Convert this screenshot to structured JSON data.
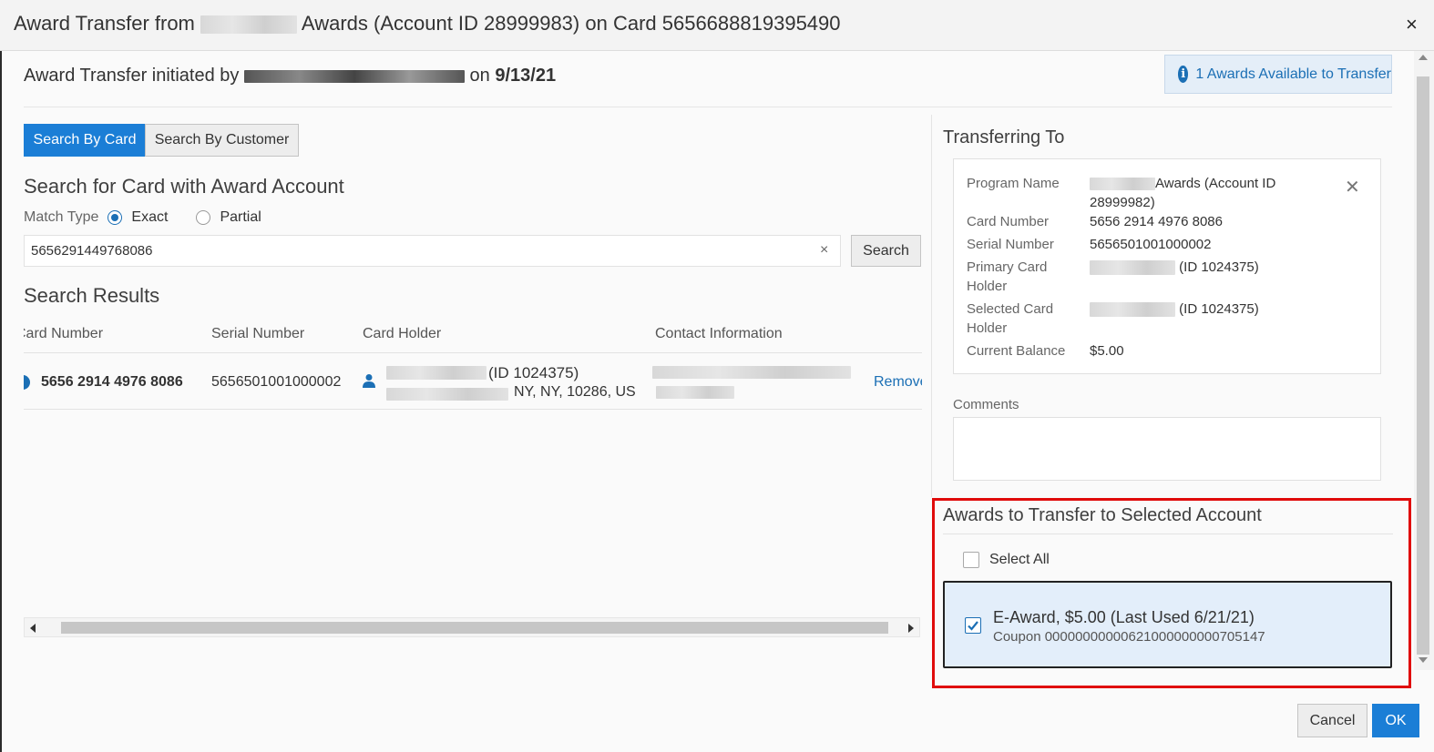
{
  "dialog": {
    "title_prefix": "Award Transfer from",
    "title_suffix": "Awards (Account ID 28999983) on Card 5656688819395490",
    "close_glyph": "×"
  },
  "header": {
    "initiated_prefix": "Award Transfer initiated by",
    "initiated_on": "on",
    "initiated_date": "9/13/21",
    "awards_available": "1 Awards Available to Transfer",
    "info_glyph": "i"
  },
  "search": {
    "tabs": [
      "Search By Card",
      "Search By Customer"
    ],
    "heading": "Search for Card with Award Account",
    "match_type_label": "Match Type",
    "match_options": [
      "Exact",
      "Partial"
    ],
    "selected_match": "Exact",
    "input_value": "5656291449768086",
    "clear_glyph": "×",
    "search_button": "Search"
  },
  "results": {
    "heading": "Search Results",
    "columns": [
      "Card Number",
      "Serial Number",
      "Card Holder",
      "Contact Information"
    ],
    "rows": [
      {
        "card_number": "5656 2914 4976 8086",
        "serial_number": "5656501001000002",
        "holder_id": "(ID 1024375)",
        "holder_address": "NY, NY, 10286, US",
        "action": "Remove"
      }
    ]
  },
  "transferring_to": {
    "heading": "Transferring To",
    "close_glyph": "✕",
    "program_name_label": "Program Name",
    "program_name_value_line1": "Awards (Account ID",
    "program_name_value_line2": "28999982)",
    "card_number_label": "Card Number",
    "card_number_value": "5656 2914 4976 8086",
    "serial_number_label": "Serial Number",
    "serial_number_value": "5656501001000002",
    "primary_holder_label_line1": "Primary Card",
    "primary_holder_label_line2": "Holder",
    "primary_holder_value": "(ID 1024375)",
    "selected_holder_label_line1": "Selected Card",
    "selected_holder_label_line2": "Holder",
    "selected_holder_value": "(ID 1024375)",
    "current_balance_label": "Current Balance",
    "current_balance_value": "$5.00"
  },
  "comments": {
    "label": "Comments",
    "value": ""
  },
  "awards": {
    "heading": "Awards to Transfer to Selected Account",
    "select_all_label": "Select All",
    "select_all_checked": false,
    "items": [
      {
        "title": "E-Award, $5.00 (Last Used 6/21/21)",
        "coupon": "Coupon 00000000000621000000000705147",
        "checked": true
      }
    ]
  },
  "footer": {
    "cancel": "Cancel",
    "ok": "OK"
  },
  "colors": {
    "accent_blue": "#1b7ed6",
    "link_blue": "#1b6fb5",
    "highlight_red": "#e00b0b",
    "award_card_bg": "#e3eefa"
  }
}
